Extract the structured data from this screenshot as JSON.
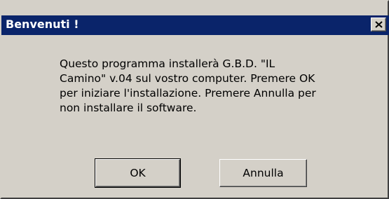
{
  "window": {
    "title": "Benvenuti !"
  },
  "message": {
    "text": "Questo programma installerà  G.B.D. \"IL\nCamino\" v.04 sul vostro computer. Premere OK\nper iniziare l'installazione. Premere Annulla per\nnon installare il software."
  },
  "buttons": {
    "ok_label": "OK",
    "cancel_label": "Annulla"
  },
  "icons": {
    "close": "close-icon"
  },
  "colors": {
    "titlebar": "#0a246a",
    "face": "#d4d0c8"
  }
}
